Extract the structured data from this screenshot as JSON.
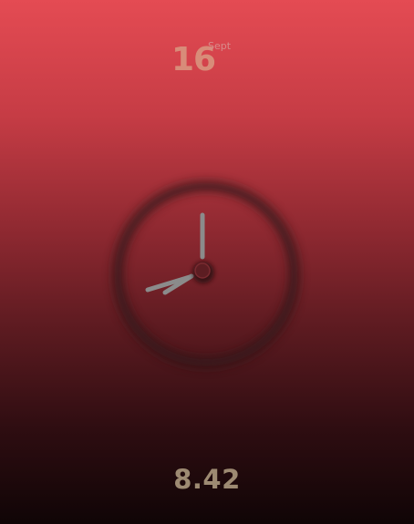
{
  "date": {
    "day": "16",
    "month": "Sept"
  },
  "clock": {
    "hour": 8,
    "minute": 42,
    "hand_color": "#8b8b8b",
    "ring_color": "#3a1d20",
    "center_color": "#5c1d22"
  },
  "time": {
    "display": "8.42"
  },
  "colors": {
    "background_top": "#e44b53",
    "background_bottom": "#100506",
    "day_color": "#d88c79",
    "month_color": "#d98a8a",
    "time_color": "#9d8a72"
  }
}
